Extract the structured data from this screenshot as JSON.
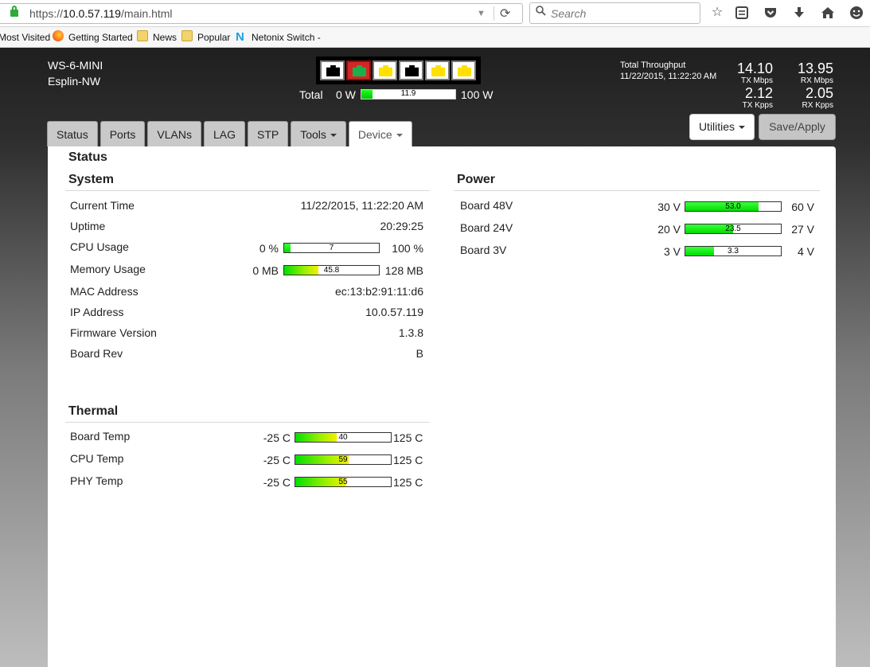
{
  "browser": {
    "url_prefix": "https://",
    "url_host": "10.0.57.119",
    "url_path": "/main.html",
    "search_placeholder": "Search",
    "bookmarks": [
      "Most Visited",
      "Getting Started",
      "News",
      "Popular",
      "Netonix Switch -"
    ]
  },
  "header": {
    "model": "WS-6-MINI",
    "location": "Esplin-NW",
    "ports": [
      {
        "state": "black"
      },
      {
        "state": "green"
      },
      {
        "state": "yellow"
      },
      {
        "state": "black"
      },
      {
        "state": "yellow"
      },
      {
        "state": "yellow"
      }
    ],
    "power": {
      "label": "Total",
      "min_label": "0 W",
      "max_label": "100 W",
      "value": "11.9",
      "min": 0,
      "max": 100
    },
    "throughput": {
      "title": "Total Throughput",
      "timestamp": "11/22/2015, 11:22:20 AM",
      "tx_mbps": "14.10",
      "tx_mbps_unit": "TX Mbps",
      "rx_mbps": "13.95",
      "rx_mbps_unit": "RX Mbps",
      "tx_kpps": "2.12",
      "tx_kpps_unit": "TX Kpps",
      "rx_kpps": "2.05",
      "rx_kpps_unit": "RX Kpps"
    }
  },
  "tabs": [
    {
      "label": "Status",
      "dropdown": false
    },
    {
      "label": "Ports",
      "dropdown": false
    },
    {
      "label": "VLANs",
      "dropdown": false
    },
    {
      "label": "LAG",
      "dropdown": false
    },
    {
      "label": "STP",
      "dropdown": false
    },
    {
      "label": "Tools",
      "dropdown": true
    },
    {
      "label": "Device",
      "dropdown": true,
      "active": true
    }
  ],
  "buttons": {
    "utilities": "Utilities",
    "save": "Save/Apply"
  },
  "status": {
    "title": "Status",
    "system_title": "System",
    "system": {
      "current_time": {
        "label": "Current Time",
        "value": "11/22/2015, 11:22:20 AM"
      },
      "uptime": {
        "label": "Uptime",
        "value": "20:29:25"
      },
      "cpu": {
        "label": "CPU Usage",
        "min_label": "0 %",
        "max_label": "100 %",
        "value": "7",
        "min": 0,
        "max": 100
      },
      "memory": {
        "label": "Memory Usage",
        "min_label": "0 MB",
        "max_label": "128 MB",
        "value": "45.8",
        "min": 0,
        "max": 128
      },
      "mac": {
        "label": "MAC Address",
        "value": "ec:13:b2:91:11:d6"
      },
      "ip": {
        "label": "IP Address",
        "value": "10.0.57.119"
      },
      "firmware": {
        "label": "Firmware Version",
        "value": "1.3.8"
      },
      "board_rev": {
        "label": "Board Rev",
        "value": "B"
      }
    },
    "thermal_title": "Thermal",
    "thermal": [
      {
        "label": "Board Temp",
        "min_label": "-25 C",
        "max_label": "125 C",
        "value": "40",
        "min": -25,
        "max": 125
      },
      {
        "label": "CPU Temp",
        "min_label": "-25 C",
        "max_label": "125 C",
        "value": "59",
        "min": -25,
        "max": 125
      },
      {
        "label": "PHY Temp",
        "min_label": "-25 C",
        "max_label": "125 C",
        "value": "55",
        "min": -25,
        "max": 125
      }
    ],
    "power_title": "Power",
    "power": [
      {
        "label": "Board 48V",
        "min_label": "30 V",
        "max_label": "60 V",
        "value": "53.0",
        "min": 30,
        "max": 60
      },
      {
        "label": "Board 24V",
        "min_label": "20 V",
        "max_label": "27 V",
        "value": "23.5",
        "min": 20,
        "max": 27
      },
      {
        "label": "Board 3V",
        "min_label": "3 V",
        "max_label": "4 V",
        "value": "3.3",
        "min": 3,
        "max": 4
      }
    ]
  }
}
